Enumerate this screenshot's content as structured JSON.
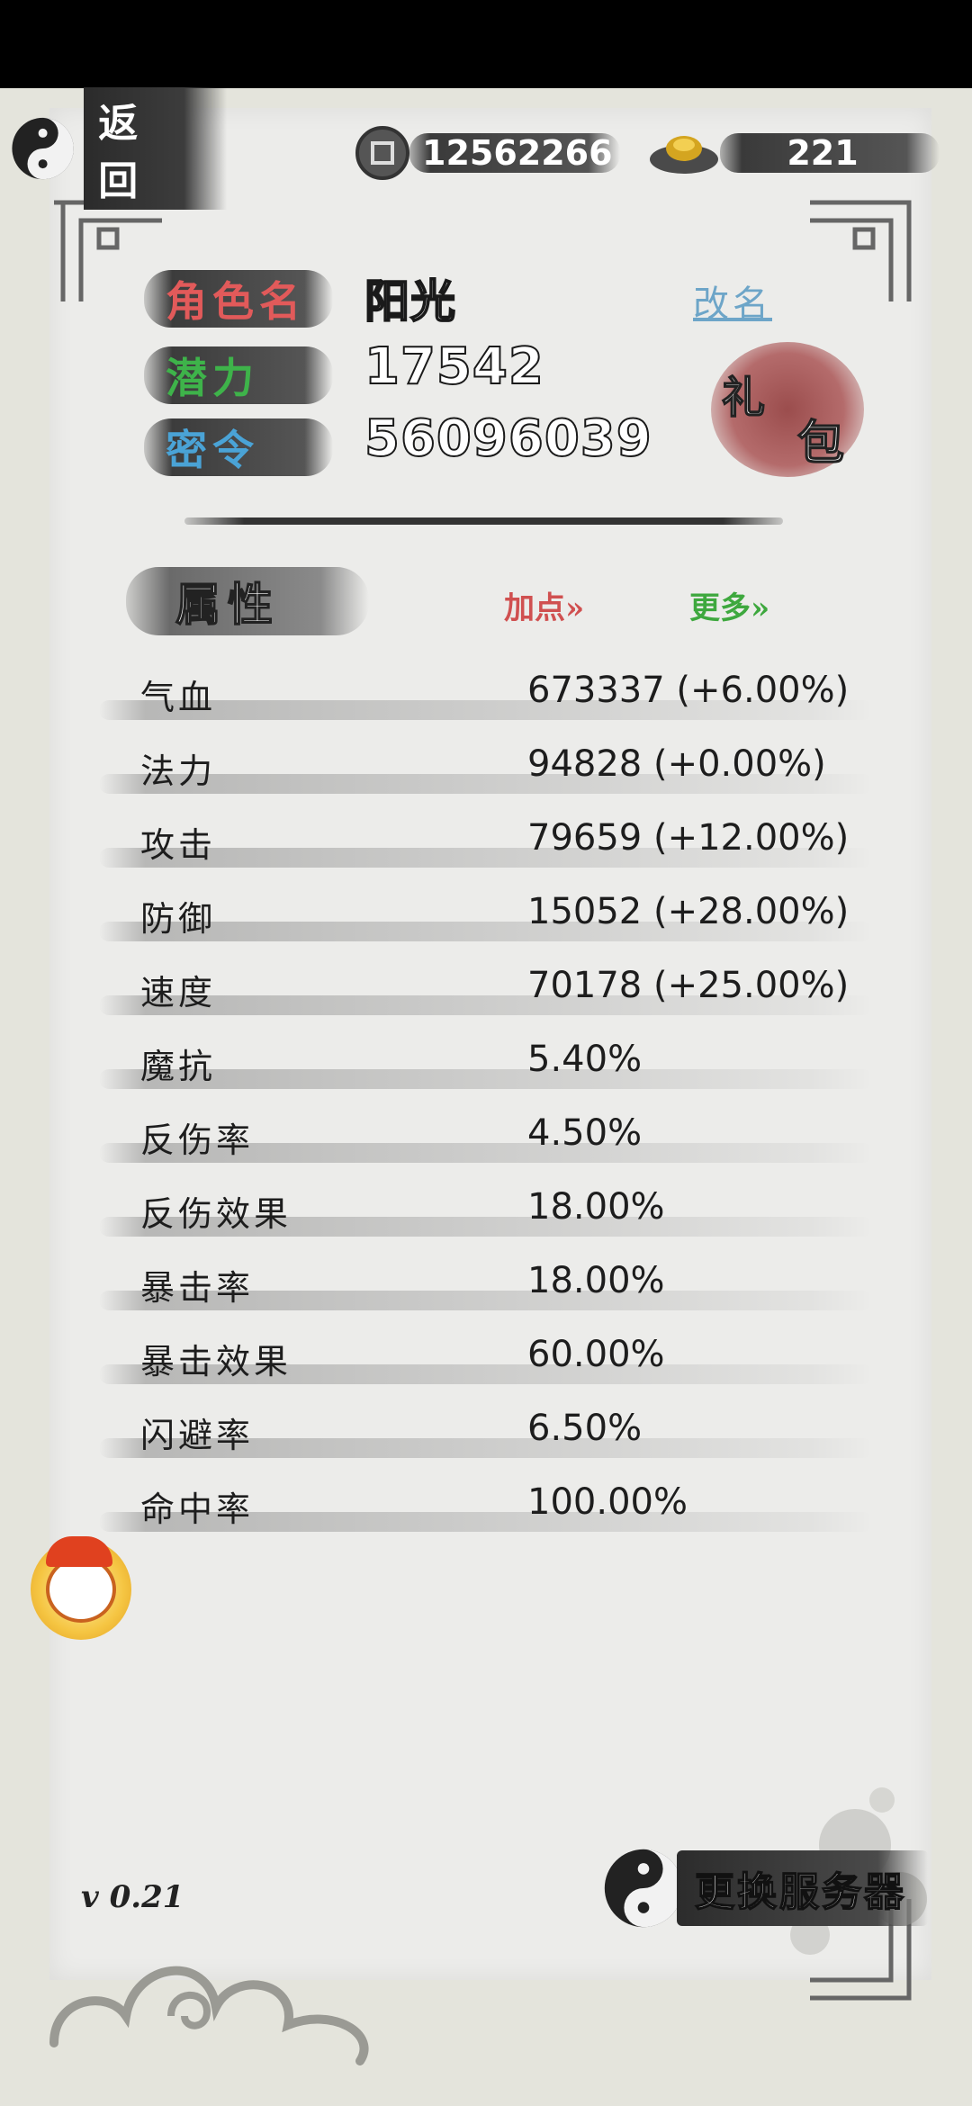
{
  "topbar": {
    "back_label": "返回",
    "coins": "12562266",
    "ingots": "221"
  },
  "profile": {
    "name_label": "角色名",
    "name_value": "阳光",
    "potential_label": "潜力",
    "potential_value": "17542",
    "password_label": "密令",
    "password_value": "56096039",
    "rename_label": "改名",
    "gift_label_1": "礼",
    "gift_label_2": "包"
  },
  "attributes": {
    "title": "属性",
    "add_points_label": "加点»",
    "more_label": "更多»",
    "rows": [
      {
        "name": "气血",
        "value": "673337 (+6.00%)"
      },
      {
        "name": "法力",
        "value": "94828 (+0.00%)"
      },
      {
        "name": "攻击",
        "value": "79659 (+12.00%)"
      },
      {
        "name": "防御",
        "value": "15052 (+28.00%)"
      },
      {
        "name": "速度",
        "value": "70178 (+25.00%)"
      },
      {
        "name": "魔抗",
        "value": "5.40%"
      },
      {
        "name": "反伤率",
        "value": "4.50%"
      },
      {
        "name": "反伤效果",
        "value": "18.00%"
      },
      {
        "name": "暴击率",
        "value": "18.00%"
      },
      {
        "name": "暴击效果",
        "value": "60.00%"
      },
      {
        "name": "闪避率",
        "value": "6.50%"
      },
      {
        "name": "命中率",
        "value": "100.00%"
      }
    ]
  },
  "footer": {
    "version": "v 0.21",
    "switch_server_label": "更换服务器"
  },
  "colors": {
    "name_label": "#e25a5a",
    "potential_label": "#3eb34a",
    "password_label": "#4aa3d6",
    "rename_link": "#6da5c8",
    "add_points": "#d05050",
    "more": "#3ea83e"
  }
}
